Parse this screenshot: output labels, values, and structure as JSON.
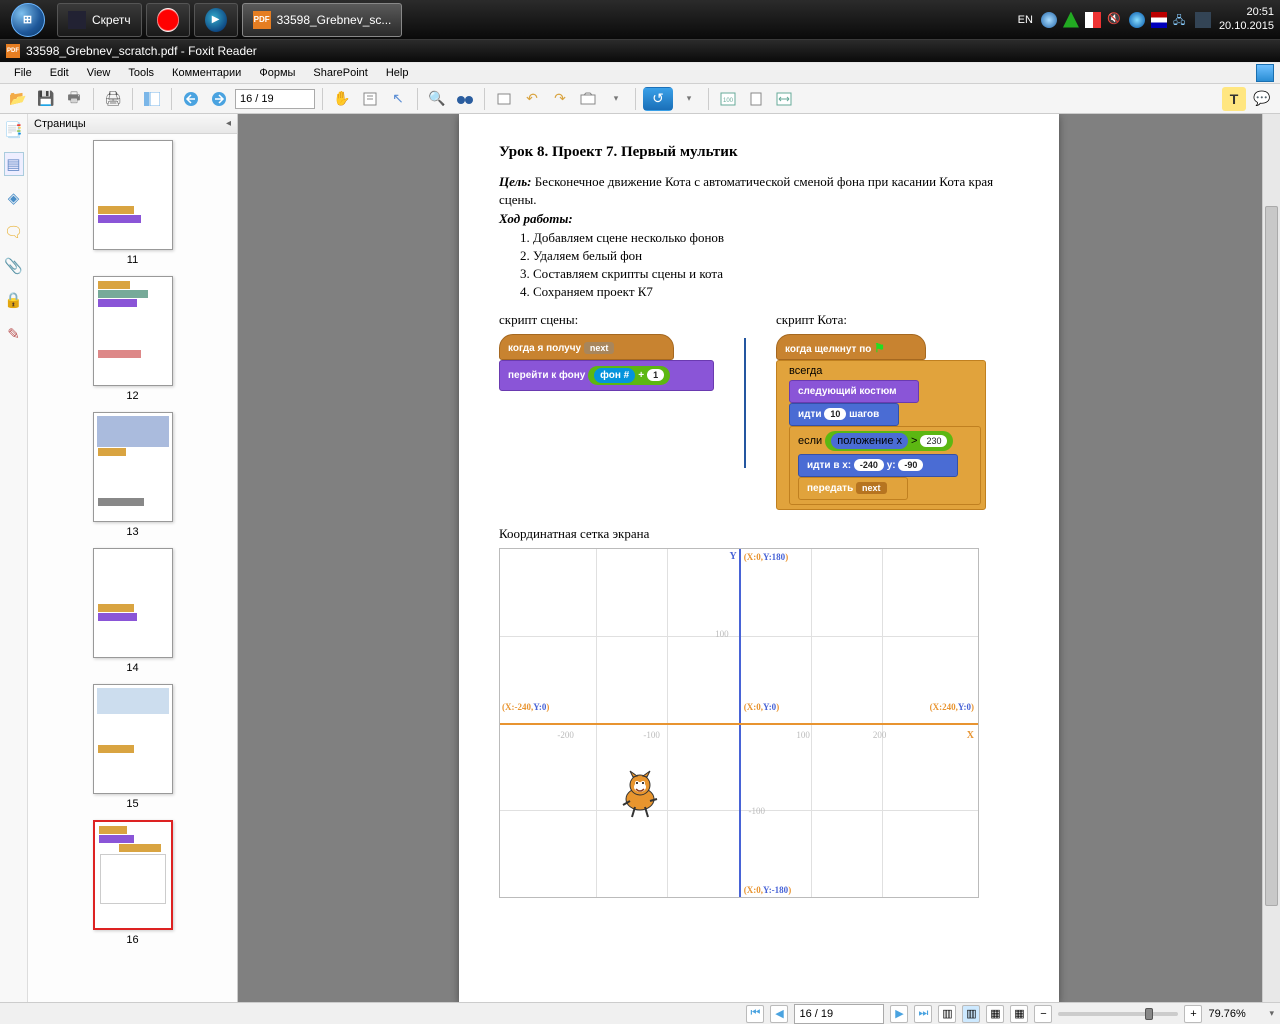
{
  "taskbar": {
    "items": [
      {
        "label": "Скретч"
      },
      {
        "label": ""
      },
      {
        "label": ""
      },
      {
        "label": "33598_Grebnev_sc..."
      }
    ],
    "lang": "EN",
    "clock_time": "20:51",
    "clock_date": "20.10.2015"
  },
  "app": {
    "title": "33598_Grebnev_scratch.pdf - Foxit Reader",
    "menu": [
      "File",
      "Edit",
      "View",
      "Tools",
      "Комментарии",
      "Формы",
      "SharePoint",
      "Help"
    ],
    "page_input": "16 / 19",
    "panel_title": "Страницы",
    "thumbs": [
      "11",
      "12",
      "13",
      "14",
      "15",
      "16"
    ],
    "status_page": "16 / 19",
    "zoom": "79.76%"
  },
  "doc": {
    "h": "Урок 8. Проект 7. Первый мультик",
    "goal_lbl": "Цель:",
    "goal": "Бесконечное движение Кота с автоматической сменой фона при касании Кота края сцены.",
    "steps_lbl": "Ход работы:",
    "steps": [
      "Добавляем сцене несколько фонов",
      "Удаляем белый фон",
      "Составляем скрипты сцены и кота",
      "Сохраняем проект К7"
    ],
    "scene_script_lbl": "скрипт сцены:",
    "cat_script_lbl": "скрипт Кота:",
    "scene": {
      "hat": "когда я получу",
      "hat_dd": "next",
      "goto": "перейти к фону",
      "bg_lbl": "фон #",
      "plus": "+",
      "one": "1"
    },
    "cat": {
      "hat": "когда щелкнут по",
      "forever": "всегда",
      "next_cost": "следующий костюм",
      "move": "идти",
      "move_n": "10",
      "move_steps": "шагов",
      "if": "если",
      "posx": "положение x",
      "gt": ">",
      "v230": "230",
      "goxy": "идти в x:",
      "vx": "-240",
      "y": "y:",
      "vy": "-90",
      "bcast": "передать",
      "bcast_dd": "next"
    },
    "grid_lbl": "Координатная сетка экрана",
    "grid": {
      "Y": "Y",
      "X": "X",
      "top": "(X:0,Y:180)",
      "bottom": "(X:0,Y:-180)",
      "left": "(X:-240,Y:0)",
      "right": "(X:240,Y:0)",
      "center": "(X:0,Y:0)",
      "t200n": "-200",
      "t100n": "-100",
      "t100": "100",
      "t200": "200",
      "ty100": "100",
      "tyn100": "-100"
    }
  }
}
